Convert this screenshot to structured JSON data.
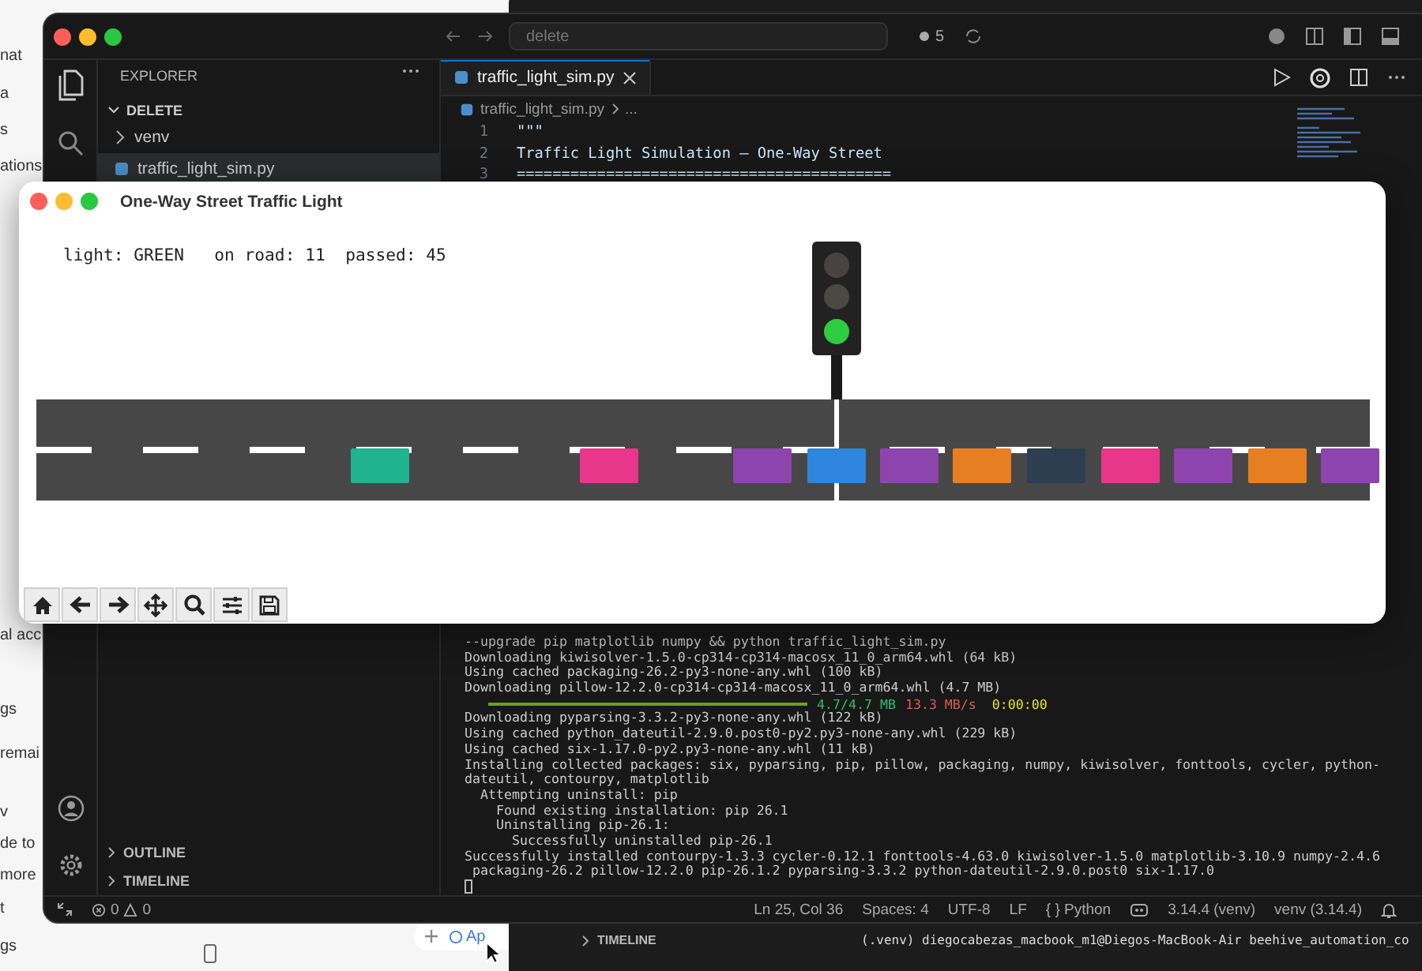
{
  "desktop": {
    "left_window_texts": [
      "nat",
      "a",
      "s",
      "ations",
      "al acc",
      "gs",
      "remai",
      "v",
      "de to",
      "more",
      "t",
      "gs"
    ],
    "dock_fragment": "Ap"
  },
  "back_window": {
    "section": "TIMELINE",
    "terminal_prompt": "(.venv) diegocabezas_macbook_m1@Diegos-MacBook-Air beehive_automation_co"
  },
  "editor_window": {
    "command_center": "delete",
    "badge": "5",
    "explorer": {
      "title": "EXPLORER",
      "folder": "DELETE",
      "items": [
        {
          "label": "venv",
          "kind": "folder",
          "selected": false
        },
        {
          "label": "traffic_light_sim.py",
          "kind": "python",
          "selected": true
        }
      ]
    },
    "sections": [
      "OUTLINE",
      "TIMELINE"
    ],
    "tabs": [
      {
        "label": "traffic_light_sim.py",
        "selected": true
      }
    ],
    "breadcrumb": [
      "traffic_light_sim.py",
      "..."
    ],
    "code_lines": [
      {
        "number": "1",
        "text": "\"\"\""
      },
      {
        "number": "2",
        "text": "Traffic Light Simulation — One-Way Street"
      },
      {
        "number": "3",
        "text": "=========================================="
      }
    ],
    "terminal_lines": [
      {
        "kind": "text",
        "text": "--upgrade pip matplotlib numpy && python traffic_light_sim.py"
      },
      {
        "kind": "text",
        "text": "Downloading kiwisolver-1.5.0-cp314-cp314-macosx_11_0_arm64.whl (64 kB)"
      },
      {
        "kind": "text",
        "text": "Using cached packaging-26.2-py3-none-any.whl (100 kB)"
      },
      {
        "kind": "text",
        "text": "Downloading pillow-12.2.0-cp314-cp314-macosx_11_0_arm64.whl (4.7 MB)"
      },
      {
        "kind": "progress",
        "level": 1,
        "size": "4.7/4.7 MB",
        "speed": "13.3 MB/s",
        "eta": "0:00:00"
      },
      {
        "kind": "text",
        "text": "Downloading pyparsing-3.3.2-py3-none-any.whl (122 kB)"
      },
      {
        "kind": "text",
        "text": "Using cached python_dateutil-2.9.0.post0-py2.py3-none-any.whl (229 kB)"
      },
      {
        "kind": "text",
        "text": "Using cached six-1.17.0-py2.py3-none-any.whl (11 kB)"
      },
      {
        "kind": "text",
        "text": "Installing collected packages: six, pyparsing, pip, pillow, packaging, numpy, kiwisolver, fonttools, cycler, python-"
      },
      {
        "kind": "text",
        "text": "dateutil, contourpy, matplotlib"
      },
      {
        "kind": "text",
        "text": "  Attempting uninstall: pip"
      },
      {
        "kind": "text",
        "text": "    Found existing installation: pip 26.1"
      },
      {
        "kind": "text",
        "text": "    Uninstalling pip-26.1:"
      },
      {
        "kind": "text",
        "text": "      Successfully uninstalled pip-26.1"
      },
      {
        "kind": "text",
        "text": "Successfully installed contourpy-1.3.3 cycler-0.12.1 fonttools-4.63.0 kiwisolver-1.5.0 matplotlib-3.10.9 numpy-2.4.6"
      },
      {
        "kind": "text",
        "text": " packaging-26.2 pillow-12.2.0 pip-26.1.2 pyparsing-3.3.2 python-dateutil-2.9.0.post0 six-1.17.0"
      }
    ],
    "status_bar": {
      "errors": "0",
      "warnings": "0",
      "position": "Ln 25, Col 36",
      "indent": "Spaces: 4",
      "encoding": "UTF-8",
      "eol": "LF",
      "language": "{ } Python",
      "interpreter": "3.14.4 (venv)",
      "environment": "venv (3.14.4)"
    }
  },
  "plot_window": {
    "title": "One-Way Street Traffic Light",
    "status": "light: GREEN   on road: 11  passed: 45",
    "lamps": [
      {
        "kind": "red",
        "on": false
      },
      {
        "kind": "yellow",
        "on": false
      },
      {
        "kind": "green",
        "on": true
      }
    ],
    "cars": [
      {
        "color": "#1fb38e"
      },
      {
        "color": "#e8368a"
      },
      {
        "color": "#8e44ad"
      },
      {
        "color": "#2e86de"
      },
      {
        "color": "#8e44ad"
      },
      {
        "color": "#e67e22"
      },
      {
        "color": "#2c3e50"
      },
      {
        "color": "#e8368a"
      },
      {
        "color": "#8e44ad"
      },
      {
        "color": "#e67e22"
      },
      {
        "color": "#8e44ad"
      }
    ]
  }
}
